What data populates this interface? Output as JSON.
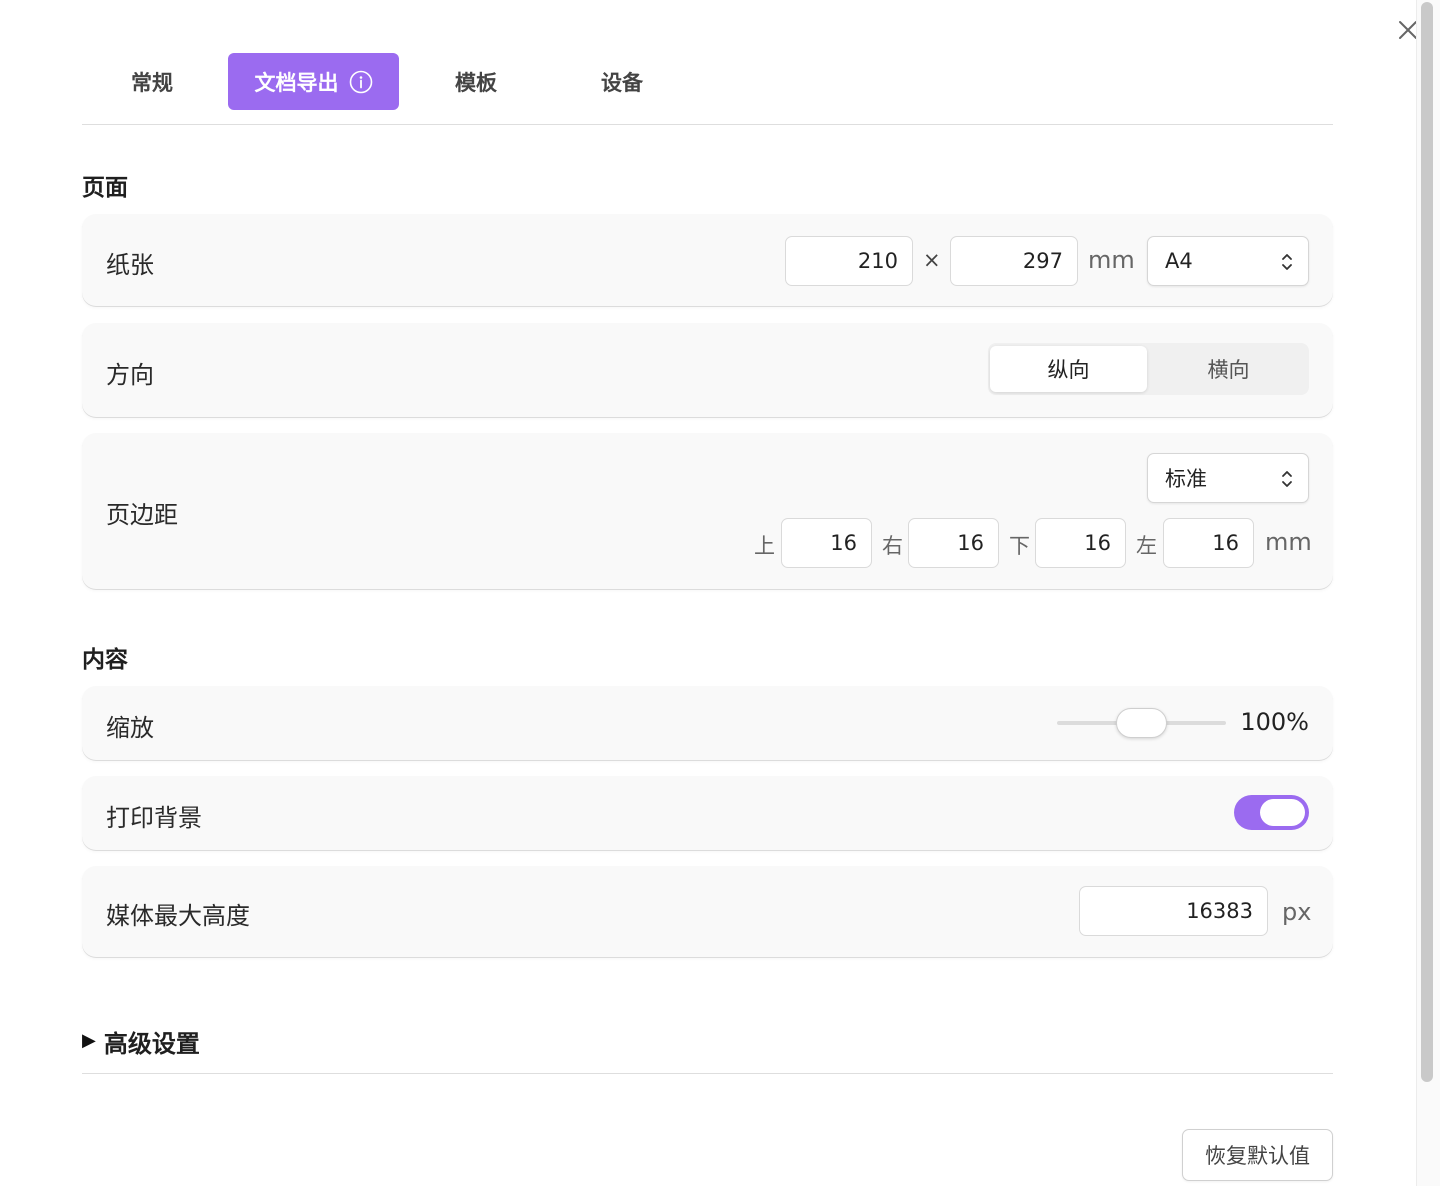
{
  "colors": {
    "accent": "#9b6bf0",
    "card_bg": "#f9f9f9"
  },
  "window": {
    "close_icon": "close-icon"
  },
  "tabs": [
    {
      "label": "常规",
      "active": false
    },
    {
      "label": "文档导出",
      "active": true,
      "icon": "info-icon"
    },
    {
      "label": "模板",
      "active": false
    },
    {
      "label": "设备",
      "active": false
    }
  ],
  "page_section": {
    "title": "页面",
    "paper": {
      "label": "纸张",
      "width": "210",
      "times": "×",
      "height": "297",
      "unit": "mm",
      "size_select": "A4"
    },
    "orientation": {
      "label": "方向",
      "options": [
        "纵向",
        "横向"
      ],
      "selected": "纵向"
    },
    "margins": {
      "label": "页边距",
      "preset_select": "标准",
      "top_label": "上",
      "top": "16",
      "right_label": "右",
      "right": "16",
      "bottom_label": "下",
      "bottom": "16",
      "left_label": "左",
      "left": "16",
      "unit": "mm"
    }
  },
  "content_section": {
    "title": "内容",
    "zoom": {
      "label": "缩放",
      "value": "100%",
      "slider_fraction": 0.38
    },
    "print_background": {
      "label": "打印背景",
      "enabled": true
    },
    "media_max_height": {
      "label": "媒体最大高度",
      "value": "16383",
      "unit": "px"
    }
  },
  "advanced": {
    "triangle": "▶",
    "label": "高级设置"
  },
  "footer": {
    "reset_label": "恢复默认值"
  }
}
